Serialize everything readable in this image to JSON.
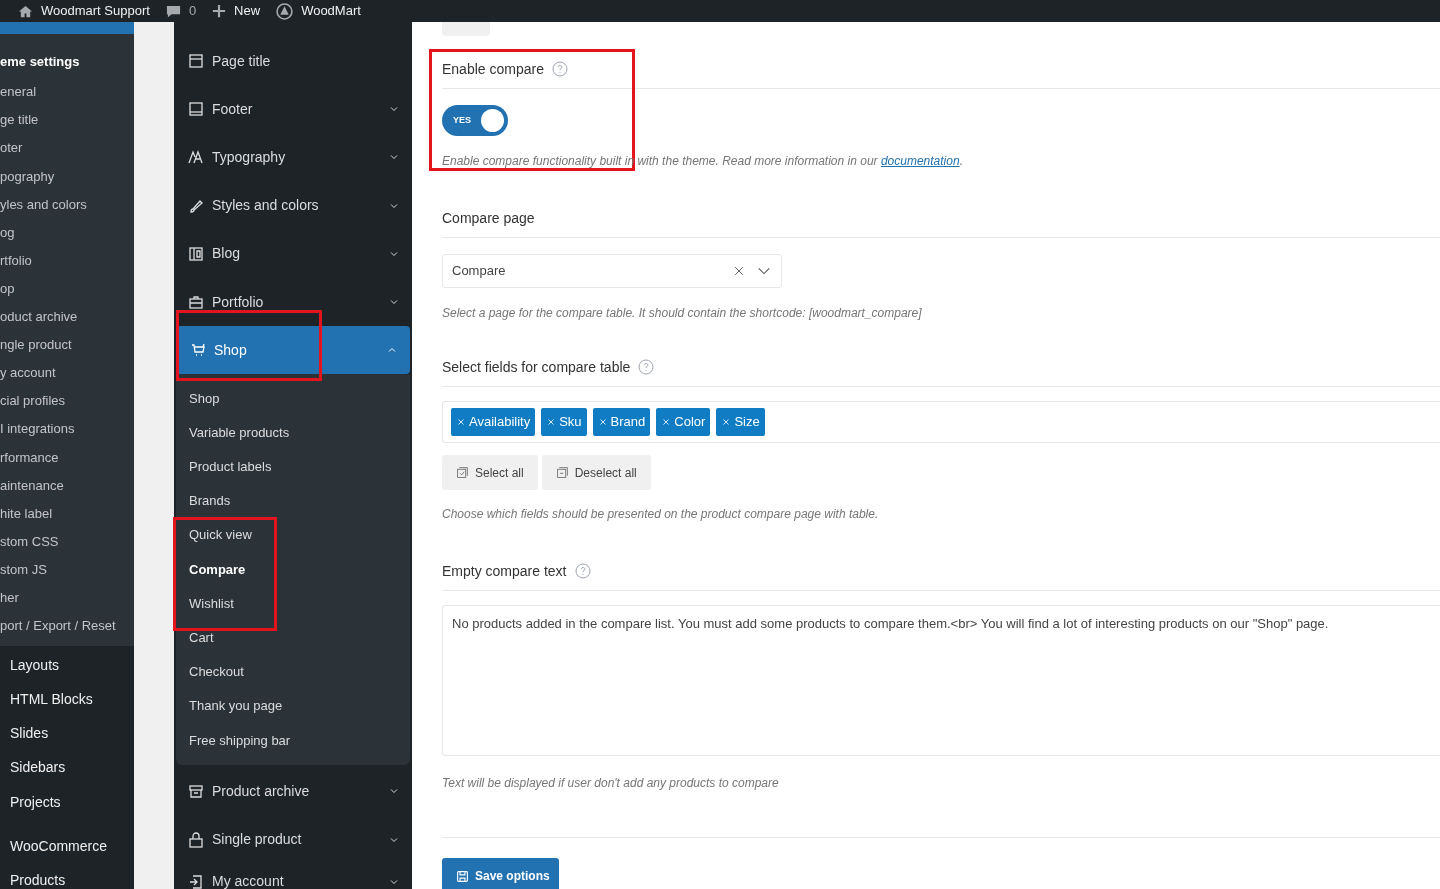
{
  "admin_bar": {
    "site": "Woodmart Support",
    "comments": "0",
    "new": "New",
    "theme": "WoodMart"
  },
  "wp_menu": {
    "section_title": "eme settings",
    "sub_items": [
      "eneral",
      "ge title",
      "oter",
      "pography",
      "yles and colors",
      "og",
      "rtfolio",
      "op",
      "oduct archive",
      "ngle product",
      "y account",
      "cial profiles",
      "I integrations",
      "rformance",
      "aintenance",
      "hite label",
      "stom CSS",
      "stom JS",
      "her",
      "port / Export / Reset"
    ],
    "items": [
      "Layouts",
      "HTML Blocks",
      "Slides",
      "Sidebars",
      "Projects",
      "WooCommerce",
      "Products"
    ]
  },
  "settings_nav": [
    {
      "label": "Page title",
      "expanded": false
    },
    {
      "label": "Footer",
      "expanded": false
    },
    {
      "label": "Typography",
      "expanded": false
    },
    {
      "label": "Styles and colors",
      "expanded": false
    },
    {
      "label": "Blog",
      "expanded": false
    },
    {
      "label": "Portfolio",
      "expanded": false
    },
    {
      "label": "Shop",
      "expanded": true,
      "children": [
        {
          "label": "Shop",
          "selected": false
        },
        {
          "label": "Variable products",
          "selected": false
        },
        {
          "label": "Product labels",
          "selected": false
        },
        {
          "label": "Brands",
          "selected": false
        },
        {
          "label": "Quick view",
          "selected": false
        },
        {
          "label": "Compare",
          "selected": true
        },
        {
          "label": "Wishlist",
          "selected": false
        },
        {
          "label": "Cart",
          "selected": false
        },
        {
          "label": "Checkout",
          "selected": false
        },
        {
          "label": "Thank you page",
          "selected": false
        },
        {
          "label": "Free shipping bar",
          "selected": false
        }
      ]
    },
    {
      "label": "Product archive",
      "expanded": false
    },
    {
      "label": "Single product",
      "expanded": false
    },
    {
      "label": "My account",
      "expanded": false
    }
  ],
  "settings": {
    "enable_compare": {
      "label": "Enable compare",
      "on": true,
      "toggle_text": "YES",
      "description": "Enable compare functionality built in with the theme. Read more information in our ",
      "link": "documentation",
      "link_suffix": "."
    },
    "compare_page": {
      "label": "Compare page",
      "value": "Compare",
      "description": "Select a page for the compare table. It should contain the shortcode: [woodmart_compare]"
    },
    "compare_fields": {
      "label": "Select fields for compare table",
      "tags": [
        "Availability",
        "Sku",
        "Brand",
        "Color",
        "Size"
      ],
      "buttons": [
        "Select all",
        "Deselect all"
      ],
      "description": "Choose which fields should be presented on the product compare page with table."
    },
    "empty_text": {
      "label": "Empty compare text",
      "value": "No products added in the compare list. You must add some products to compare them.<br> You will find a lot of interesting products on our \"Shop\" page.",
      "description": "Text will be displayed if user don't add any products to compare"
    }
  },
  "save_button": "Save options"
}
